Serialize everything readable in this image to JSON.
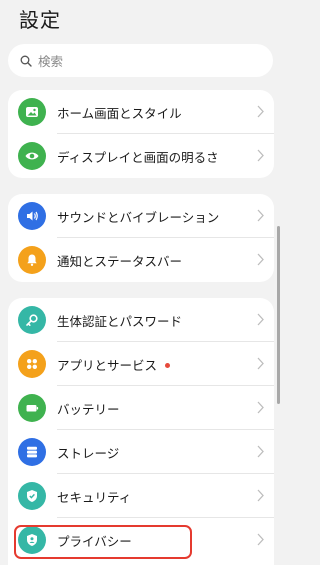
{
  "header": {
    "title": "設定"
  },
  "search": {
    "placeholder": "検索",
    "icon": "search-icon"
  },
  "colors": {
    "green": "#3fb24f",
    "blue": "#2f6fe4",
    "orange": "#f4a11b",
    "teal": "#35b7a6",
    "highlight": "#e53a2f",
    "badge": "#e64a3b"
  },
  "groups": [
    {
      "items": [
        {
          "label": "ホーム画面とスタイル",
          "icon": "image-icon"
        },
        {
          "label": "ディスプレイと画面の明るさ",
          "icon": "eye-icon"
        }
      ]
    },
    {
      "items": [
        {
          "label": "サウンドとバイブレーション",
          "icon": "speaker-icon"
        },
        {
          "label": "通知とステータスバー",
          "icon": "bell-icon"
        }
      ]
    },
    {
      "items": [
        {
          "label": "生体認証とパスワード",
          "icon": "key-icon"
        },
        {
          "label": "アプリとサービス",
          "icon": "apps-icon",
          "badge": true
        },
        {
          "label": "バッテリー",
          "icon": "battery-icon"
        },
        {
          "label": "ストレージ",
          "icon": "storage-icon"
        },
        {
          "label": "セキュリティ",
          "icon": "shield-check-icon"
        },
        {
          "label": "プライバシー",
          "icon": "privacy-shield-icon"
        }
      ]
    }
  ]
}
